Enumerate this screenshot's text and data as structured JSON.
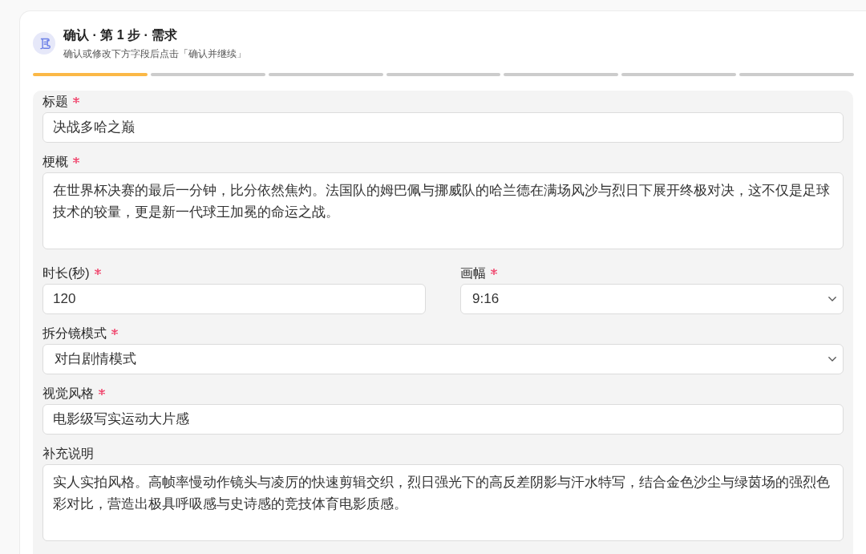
{
  "header": {
    "title": "确认 · 第 1 步 · 需求",
    "subtitle": "确认或修改下方字段后点击「确认并继续」"
  },
  "progress_steps": [
    {
      "active": true
    },
    {
      "active": false
    },
    {
      "active": false
    },
    {
      "active": false
    },
    {
      "active": false
    },
    {
      "active": false
    },
    {
      "active": false
    }
  ],
  "form": {
    "rows": [
      {
        "fields": [
          {
            "kind": "text",
            "label": "标题",
            "required": true,
            "value": "决战多哈之巅"
          }
        ]
      },
      {
        "fields": [
          {
            "kind": "textarea",
            "label": "梗概",
            "required": true,
            "value": "在世界杯决赛的最后一分钟，比分依然焦灼。法国队的姆巴佩与挪威队的哈兰德在满场风沙与烈日下展开终极对决，这不仅是足球技术的较量，更是新一代球王加冕的命运之战。"
          }
        ]
      },
      {
        "fields": [
          {
            "kind": "text",
            "label": "时长(秒)",
            "required": true,
            "value": "120"
          },
          {
            "kind": "select",
            "label": "画幅",
            "required": true,
            "value": "9:16"
          }
        ]
      },
      {
        "fields": [
          {
            "kind": "select",
            "label": "拆分镜模式",
            "required": true,
            "value": "对白剧情模式"
          }
        ]
      },
      {
        "fields": [
          {
            "kind": "text",
            "label": "视觉风格",
            "required": true,
            "value": "电影级写实运动大片感"
          }
        ]
      },
      {
        "fields": [
          {
            "kind": "textarea",
            "label": "补充说明",
            "required": false,
            "value": "实人实拍风格。高帧率慢动作镜头与凌厉的快速剪辑交织，烈日强光下的高反差阴影与汗水特写，结合金色沙尘与绿茵场的强烈色彩对比，营造出极具呼吸感与史诗感的竞技体育电影质感。"
          }
        ]
      }
    ]
  }
}
